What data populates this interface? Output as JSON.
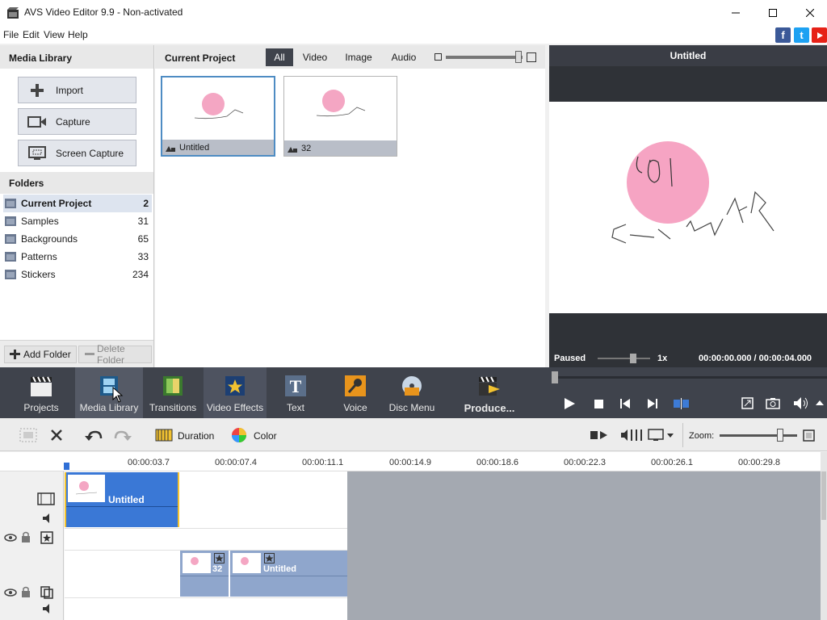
{
  "window": {
    "title": "AVS Video Editor 9.9 - Non-activated"
  },
  "menu": [
    "File",
    "Edit",
    "View",
    "Help"
  ],
  "media_library": {
    "header": "Media Library",
    "buttons": {
      "import": "Import",
      "capture": "Capture",
      "screen_capture": "Screen Capture"
    },
    "folders_header": "Folders",
    "folders": [
      {
        "name": "Current Project",
        "count": "2"
      },
      {
        "name": "Samples",
        "count": "31"
      },
      {
        "name": "Backgrounds",
        "count": "65"
      },
      {
        "name": "Patterns",
        "count": "33"
      },
      {
        "name": "Stickers",
        "count": "234"
      }
    ],
    "add_folder": "Add Folder",
    "delete_folder": "Delete Folder"
  },
  "project": {
    "header": "Current Project",
    "filters": [
      "All",
      "Video",
      "Image",
      "Audio"
    ],
    "items": [
      {
        "name": "Untitled"
      },
      {
        "name": "32"
      }
    ]
  },
  "preview": {
    "title": "Untitled",
    "status": "Paused",
    "speed": "1x",
    "time": "00:00:00.000 / 00:00:04.000"
  },
  "toolbar": {
    "projects": "Projects",
    "media_library": "Media Library",
    "transitions": "Transitions",
    "video_effects": "Video Effects",
    "text": "Text",
    "voice": "Voice",
    "disc_menu": "Disc Menu",
    "produce": "Produce..."
  },
  "edit": {
    "duration": "Duration",
    "color": "Color",
    "zoom": "Zoom:"
  },
  "timeline": {
    "ruler": [
      "00:00:03.7",
      "00:00:07.4",
      "00:00:11.1",
      "00:00:14.9",
      "00:00:18.6",
      "00:00:22.3",
      "00:00:26.1",
      "00:00:29.8"
    ],
    "clips": {
      "main": "Untitled",
      "effect1": "32",
      "effect2": "Untitled"
    }
  },
  "colors": {
    "accent": "#4e8cc3",
    "clip_blue": "#3a78d6",
    "dark_panel": "#3f434c"
  }
}
